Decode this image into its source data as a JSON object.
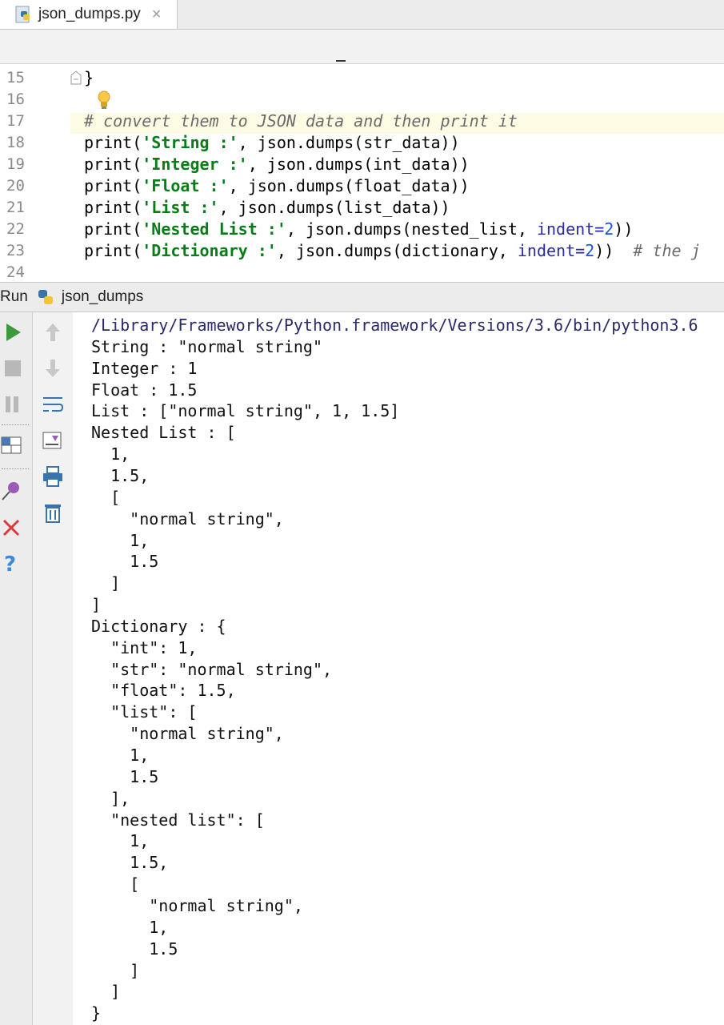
{
  "tab": {
    "filename": "json_dumps.py",
    "close": "×"
  },
  "editor": {
    "line_numbers": [
      "15",
      "16",
      "17",
      "18",
      "19",
      "20",
      "21",
      "22",
      "23",
      "24"
    ],
    "line15": "}",
    "line17": "# convert them to JSON data and then print it",
    "line18": {
      "a": "print(",
      "s": "'String :'",
      "b": ", json.dumps(str_data))"
    },
    "line19": {
      "a": "print(",
      "s": "'Integer :'",
      "b": ", json.dumps(int_data))"
    },
    "line20": {
      "a": "print(",
      "s": "'Float :'",
      "b": ", json.dumps(float_data))"
    },
    "line21": {
      "a": "print(",
      "s": "'List :'",
      "b": ", json.dumps(list_data))"
    },
    "line22": {
      "a": "print(",
      "s": "'Nested List :'",
      "b": ", json.dumps(nested_list, ",
      "p": "indent=",
      "n": "2",
      "c": "))"
    },
    "line23": {
      "a": "print(",
      "s": "'Dictionary :'",
      "b": ", json.dumps(dictionary, ",
      "p": "indent=",
      "n": "2",
      "c": "))",
      "comment": "  # the j"
    }
  },
  "run": {
    "label": "Run",
    "config": "json_dumps"
  },
  "console": {
    "lines": [
      "/Library/Frameworks/Python.framework/Versions/3.6/bin/python3.6",
      "String : \"normal string\"",
      "Integer : 1",
      "Float : 1.5",
      "List : [\"normal string\", 1, 1.5]",
      "Nested List : [",
      "  1,",
      "  1.5,",
      "  [",
      "    \"normal string\",",
      "    1,",
      "    1.5",
      "  ]",
      "]",
      "Dictionary : {",
      "  \"int\": 1,",
      "  \"str\": \"normal string\",",
      "  \"float\": 1.5,",
      "  \"list\": [",
      "    \"normal string\",",
      "    1,",
      "    1.5",
      "  ],",
      "  \"nested list\": [",
      "    1,",
      "    1.5,",
      "    [",
      "      \"normal string\",",
      "      1,",
      "      1.5",
      "    ]",
      "  ]",
      "}"
    ]
  },
  "icons": {
    "python_file": "python-file-icon",
    "run": "run-icon",
    "stop": "stop-icon",
    "pause": "pause-icon",
    "layout": "layout-icon",
    "pin": "pin-icon",
    "close": "close-icon",
    "help": "help-icon",
    "up": "arrow-up-icon",
    "down": "arrow-down-icon",
    "softwrap": "soft-wrap-icon",
    "scroll_end": "scroll-to-end-icon",
    "print": "print-icon",
    "trash": "trash-icon",
    "bulb": "lightbulb-icon"
  },
  "colors": {
    "string": "#067d17",
    "param": "#2a2aa8",
    "number": "#1750eb",
    "comment": "#6b6b6b",
    "run_green": "#3c9a3c",
    "close_red": "#d93b3b",
    "help_blue": "#3b8ad9"
  }
}
